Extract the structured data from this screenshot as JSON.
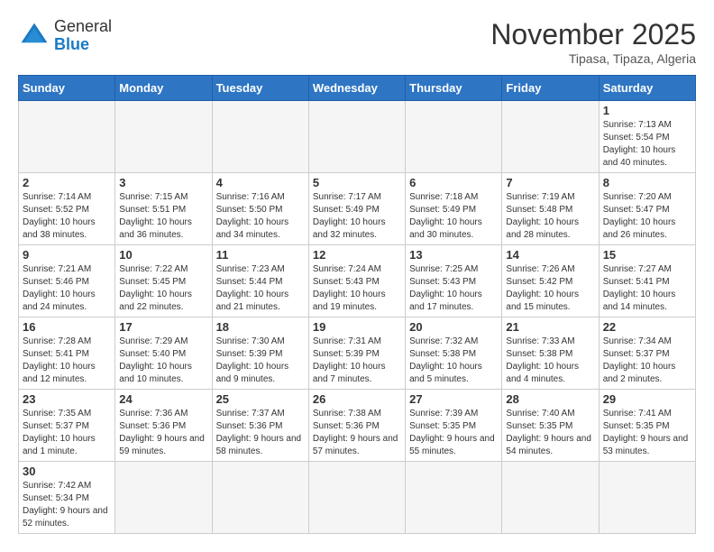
{
  "header": {
    "logo_general": "General",
    "logo_blue": "Blue",
    "month_title": "November 2025",
    "location": "Tipasa, Tipaza, Algeria"
  },
  "days_of_week": [
    "Sunday",
    "Monday",
    "Tuesday",
    "Wednesday",
    "Thursday",
    "Friday",
    "Saturday"
  ],
  "weeks": [
    [
      {
        "day": "",
        "info": ""
      },
      {
        "day": "",
        "info": ""
      },
      {
        "day": "",
        "info": ""
      },
      {
        "day": "",
        "info": ""
      },
      {
        "day": "",
        "info": ""
      },
      {
        "day": "",
        "info": ""
      },
      {
        "day": "1",
        "info": "Sunrise: 7:13 AM\nSunset: 5:54 PM\nDaylight: 10 hours and 40 minutes."
      }
    ],
    [
      {
        "day": "2",
        "info": "Sunrise: 7:14 AM\nSunset: 5:52 PM\nDaylight: 10 hours and 38 minutes."
      },
      {
        "day": "3",
        "info": "Sunrise: 7:15 AM\nSunset: 5:51 PM\nDaylight: 10 hours and 36 minutes."
      },
      {
        "day": "4",
        "info": "Sunrise: 7:16 AM\nSunset: 5:50 PM\nDaylight: 10 hours and 34 minutes."
      },
      {
        "day": "5",
        "info": "Sunrise: 7:17 AM\nSunset: 5:49 PM\nDaylight: 10 hours and 32 minutes."
      },
      {
        "day": "6",
        "info": "Sunrise: 7:18 AM\nSunset: 5:49 PM\nDaylight: 10 hours and 30 minutes."
      },
      {
        "day": "7",
        "info": "Sunrise: 7:19 AM\nSunset: 5:48 PM\nDaylight: 10 hours and 28 minutes."
      },
      {
        "day": "8",
        "info": "Sunrise: 7:20 AM\nSunset: 5:47 PM\nDaylight: 10 hours and 26 minutes."
      }
    ],
    [
      {
        "day": "9",
        "info": "Sunrise: 7:21 AM\nSunset: 5:46 PM\nDaylight: 10 hours and 24 minutes."
      },
      {
        "day": "10",
        "info": "Sunrise: 7:22 AM\nSunset: 5:45 PM\nDaylight: 10 hours and 22 minutes."
      },
      {
        "day": "11",
        "info": "Sunrise: 7:23 AM\nSunset: 5:44 PM\nDaylight: 10 hours and 21 minutes."
      },
      {
        "day": "12",
        "info": "Sunrise: 7:24 AM\nSunset: 5:43 PM\nDaylight: 10 hours and 19 minutes."
      },
      {
        "day": "13",
        "info": "Sunrise: 7:25 AM\nSunset: 5:43 PM\nDaylight: 10 hours and 17 minutes."
      },
      {
        "day": "14",
        "info": "Sunrise: 7:26 AM\nSunset: 5:42 PM\nDaylight: 10 hours and 15 minutes."
      },
      {
        "day": "15",
        "info": "Sunrise: 7:27 AM\nSunset: 5:41 PM\nDaylight: 10 hours and 14 minutes."
      }
    ],
    [
      {
        "day": "16",
        "info": "Sunrise: 7:28 AM\nSunset: 5:41 PM\nDaylight: 10 hours and 12 minutes."
      },
      {
        "day": "17",
        "info": "Sunrise: 7:29 AM\nSunset: 5:40 PM\nDaylight: 10 hours and 10 minutes."
      },
      {
        "day": "18",
        "info": "Sunrise: 7:30 AM\nSunset: 5:39 PM\nDaylight: 10 hours and 9 minutes."
      },
      {
        "day": "19",
        "info": "Sunrise: 7:31 AM\nSunset: 5:39 PM\nDaylight: 10 hours and 7 minutes."
      },
      {
        "day": "20",
        "info": "Sunrise: 7:32 AM\nSunset: 5:38 PM\nDaylight: 10 hours and 5 minutes."
      },
      {
        "day": "21",
        "info": "Sunrise: 7:33 AM\nSunset: 5:38 PM\nDaylight: 10 hours and 4 minutes."
      },
      {
        "day": "22",
        "info": "Sunrise: 7:34 AM\nSunset: 5:37 PM\nDaylight: 10 hours and 2 minutes."
      }
    ],
    [
      {
        "day": "23",
        "info": "Sunrise: 7:35 AM\nSunset: 5:37 PM\nDaylight: 10 hours and 1 minute."
      },
      {
        "day": "24",
        "info": "Sunrise: 7:36 AM\nSunset: 5:36 PM\nDaylight: 9 hours and 59 minutes."
      },
      {
        "day": "25",
        "info": "Sunrise: 7:37 AM\nSunset: 5:36 PM\nDaylight: 9 hours and 58 minutes."
      },
      {
        "day": "26",
        "info": "Sunrise: 7:38 AM\nSunset: 5:36 PM\nDaylight: 9 hours and 57 minutes."
      },
      {
        "day": "27",
        "info": "Sunrise: 7:39 AM\nSunset: 5:35 PM\nDaylight: 9 hours and 55 minutes."
      },
      {
        "day": "28",
        "info": "Sunrise: 7:40 AM\nSunset: 5:35 PM\nDaylight: 9 hours and 54 minutes."
      },
      {
        "day": "29",
        "info": "Sunrise: 7:41 AM\nSunset: 5:35 PM\nDaylight: 9 hours and 53 minutes."
      }
    ],
    [
      {
        "day": "30",
        "info": "Sunrise: 7:42 AM\nSunset: 5:34 PM\nDaylight: 9 hours and 52 minutes."
      },
      {
        "day": "",
        "info": ""
      },
      {
        "day": "",
        "info": ""
      },
      {
        "day": "",
        "info": ""
      },
      {
        "day": "",
        "info": ""
      },
      {
        "day": "",
        "info": ""
      },
      {
        "day": "",
        "info": ""
      }
    ]
  ]
}
